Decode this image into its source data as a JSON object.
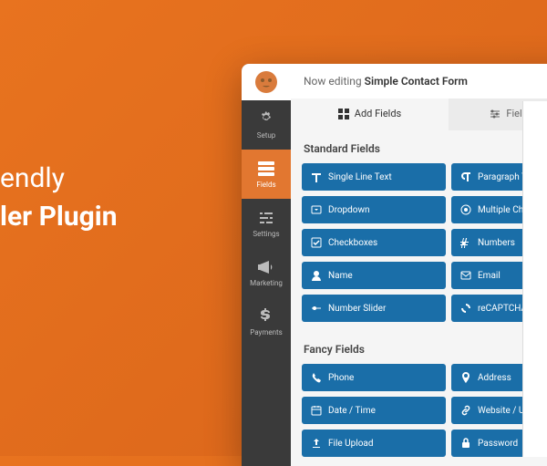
{
  "hero": {
    "line1_suffix": "endly",
    "line2_suffix": "ler Plugin"
  },
  "editing": {
    "prefix": "Now editing",
    "form_name": "Simple Contact Form"
  },
  "nav": [
    {
      "label": "Setup",
      "icon": "gear"
    },
    {
      "label": "Fields",
      "icon": "layout"
    },
    {
      "label": "Settings",
      "icon": "sliders"
    },
    {
      "label": "Marketing",
      "icon": "megaphone"
    },
    {
      "label": "Payments",
      "icon": "dollar"
    }
  ],
  "tabs": {
    "add": "Add Fields",
    "options": "Field Options"
  },
  "sections": {
    "standard": "Standard Fields",
    "fancy": "Fancy Fields"
  },
  "standard_fields": [
    {
      "label": "Single Line Text",
      "icon": "text"
    },
    {
      "label": "Paragraph Text",
      "icon": "paragraph"
    },
    {
      "label": "Dropdown",
      "icon": "dropdown"
    },
    {
      "label": "Multiple Choice",
      "icon": "radio"
    },
    {
      "label": "Checkboxes",
      "icon": "check"
    },
    {
      "label": "Numbers",
      "icon": "hash"
    },
    {
      "label": "Name",
      "icon": "user"
    },
    {
      "label": "Email",
      "icon": "mail"
    },
    {
      "label": "Number Slider",
      "icon": "slider"
    },
    {
      "label": "reCAPTCHA",
      "icon": "recaptcha"
    }
  ],
  "fancy_fields": [
    {
      "label": "Phone",
      "icon": "phone"
    },
    {
      "label": "Address",
      "icon": "pin"
    },
    {
      "label": "Date / Time",
      "icon": "calendar"
    },
    {
      "label": "Website / URL",
      "icon": "link"
    },
    {
      "label": "File Upload",
      "icon": "upload"
    },
    {
      "label": "Password",
      "icon": "lock"
    }
  ]
}
